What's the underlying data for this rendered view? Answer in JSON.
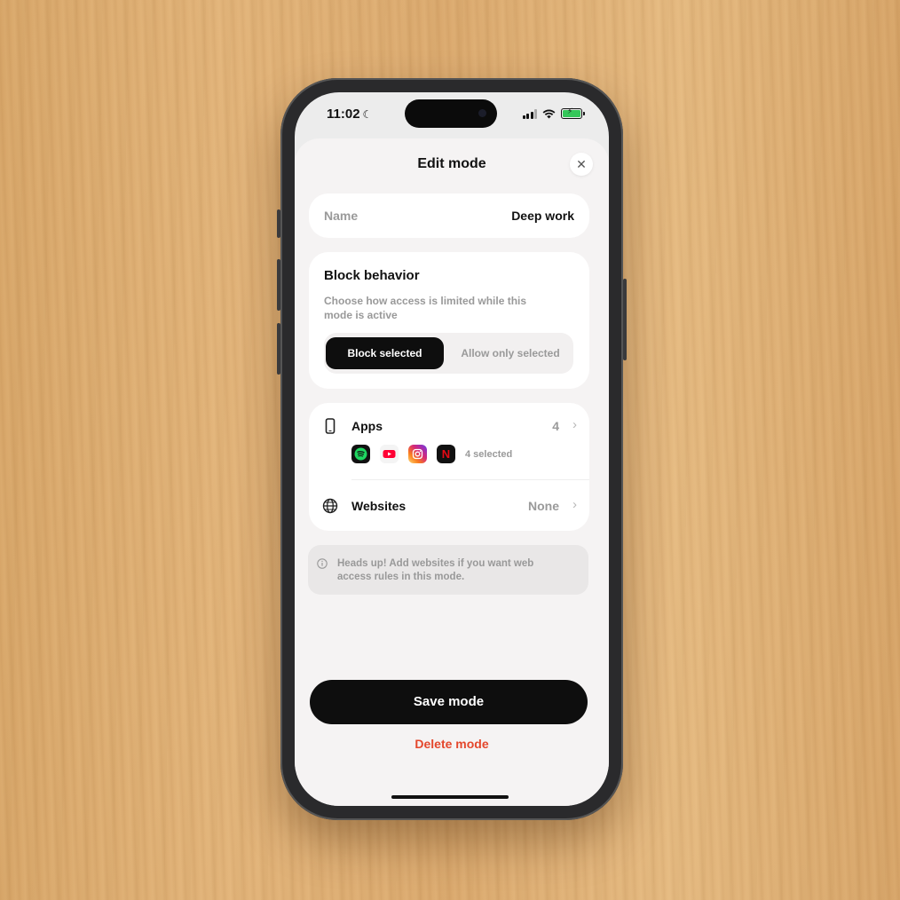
{
  "status_bar": {
    "time": "11:02"
  },
  "sheet": {
    "title": "Edit mode",
    "close_label": "✕"
  },
  "name_field": {
    "label": "Name",
    "value": "Deep work"
  },
  "block_behavior": {
    "title": "Block behavior",
    "description": "Choose how access is limited while this mode is active",
    "options": [
      {
        "label": "Block selected",
        "selected": true
      },
      {
        "label": "Allow only selected",
        "selected": false
      }
    ]
  },
  "apps": {
    "label": "Apps",
    "count": "4",
    "icons": [
      "spotify-icon",
      "youtube-icon",
      "instagram-icon",
      "netflix-icon"
    ],
    "selected_text": "4 selected"
  },
  "websites": {
    "label": "Websites",
    "value": "None"
  },
  "info": {
    "text": "Heads up! Add websites if you want web access rules in this mode."
  },
  "actions": {
    "save_label": "Save mode",
    "delete_label": "Delete mode"
  },
  "colors": {
    "accent_dark": "#0e0e0e",
    "danger": "#e4472c",
    "battery": "#34c759"
  }
}
